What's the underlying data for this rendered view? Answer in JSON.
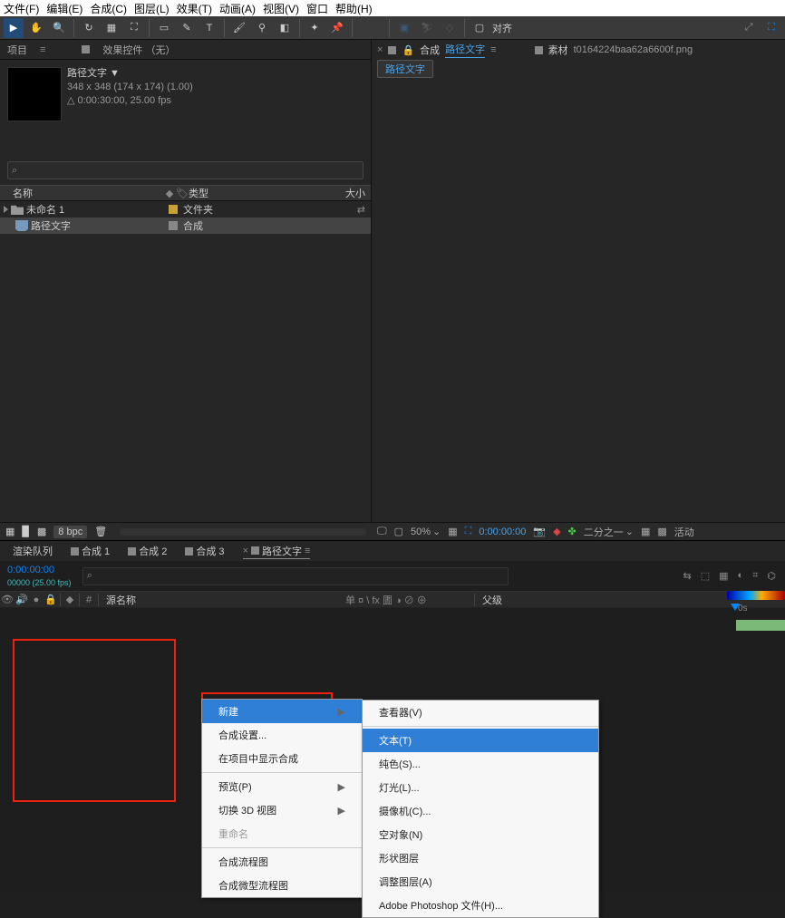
{
  "menu": {
    "file": "文件(F)",
    "edit": "编辑(E)",
    "comp": "合成(C)",
    "layer": "图层(L)",
    "effect": "效果(T)",
    "anim": "动画(A)",
    "view": "视图(V)",
    "window": "窗口",
    "help": "帮助(H)"
  },
  "toolbar": {
    "align": "对齐"
  },
  "panel": {
    "project": "项目",
    "fx": "效果控件 （无）"
  },
  "comp": {
    "name": "路径文字 ▼",
    "dim": "348 x 348  (174 x 174) (1.00)",
    "dur": "△ 0:00:30:00, 25.00 fps"
  },
  "phdr": {
    "name": "名称",
    "type": "类型",
    "size": "大小"
  },
  "items": [
    {
      "name": "未命名 1",
      "type": "文件夹",
      "kind": "folder"
    },
    {
      "name": "路径文字",
      "type": "合成",
      "kind": "comp"
    }
  ],
  "bottom": {
    "bpc": "8 bpc"
  },
  "viewer": {
    "comp": "合成",
    "compname": "路径文字",
    "mat": "素材",
    "matname": "t0164224baa62a6600f.png",
    "flow": "路径文字"
  },
  "vbot": {
    "zoom": "50%",
    "tc": "0:00:00:00",
    "res": "二分之一",
    "act": "活动"
  },
  "tabs": {
    "render": "渲染队列",
    "c1": "合成  1",
    "c2": "合成  2",
    "c3": "合成  3",
    "c4": "路径文字"
  },
  "time": {
    "main": "0:00:00:00",
    "sub": "00000 (25.00 fps)"
  },
  "tlcols": {
    "src": "源名称",
    "sw": "单 ¤ \\ fx 圕 ◑ ⊘ ⊕",
    "parent": "父级"
  },
  "ruler": {
    "t": "0s"
  },
  "ctx1": {
    "new": "新建",
    "settings": "合成设置...",
    "show": "在项目中显示合成",
    "preview": "预览(P)",
    "switch3d": "切换 3D 视图",
    "rename": "重命名",
    "flow": "合成流程图",
    "mini": "合成微型流程图"
  },
  "ctx2": {
    "viewer": "查看器(V)",
    "text": "文本(T)",
    "solid": "纯色(S)...",
    "light": "灯光(L)...",
    "camera": "摄像机(C)...",
    "null": "空对象(N)",
    "shape": "形状图层",
    "adjust": "调整图层(A)",
    "ps": "Adobe Photoshop 文件(H)..."
  }
}
